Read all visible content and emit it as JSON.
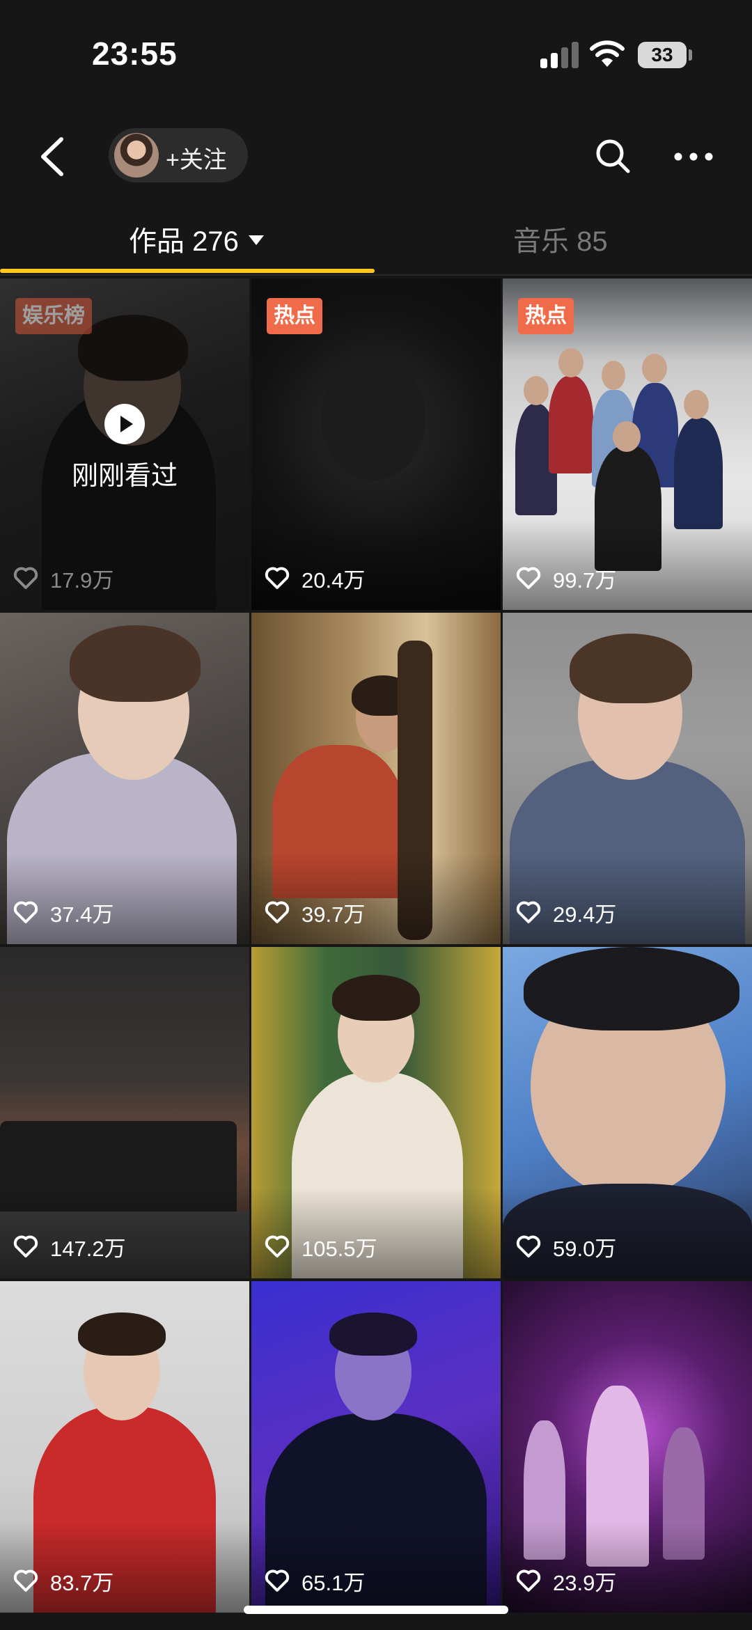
{
  "status_bar": {
    "time": "23:55",
    "battery": "33"
  },
  "header": {
    "follow_label": "+关注"
  },
  "tabs": [
    {
      "label": "作品 276",
      "active": true
    },
    {
      "label": "音乐 85",
      "active": false
    }
  ],
  "grid": [
    {
      "likes": "17.9万",
      "badge": "娱乐榜",
      "watched_label": "刚刚看过"
    },
    {
      "likes": "20.4万",
      "badge": "热点"
    },
    {
      "likes": "99.7万",
      "badge": "热点"
    },
    {
      "likes": "37.4万"
    },
    {
      "likes": "39.7万"
    },
    {
      "likes": "29.4万"
    },
    {
      "likes": "147.2万"
    },
    {
      "likes": "105.5万"
    },
    {
      "likes": "59.0万"
    },
    {
      "likes": "83.7万"
    },
    {
      "likes": "65.1万"
    },
    {
      "likes": "23.9万"
    }
  ],
  "colors": {
    "accent": "#ffc81e",
    "badge_hot": "#f06b4a",
    "background": "#161616"
  }
}
